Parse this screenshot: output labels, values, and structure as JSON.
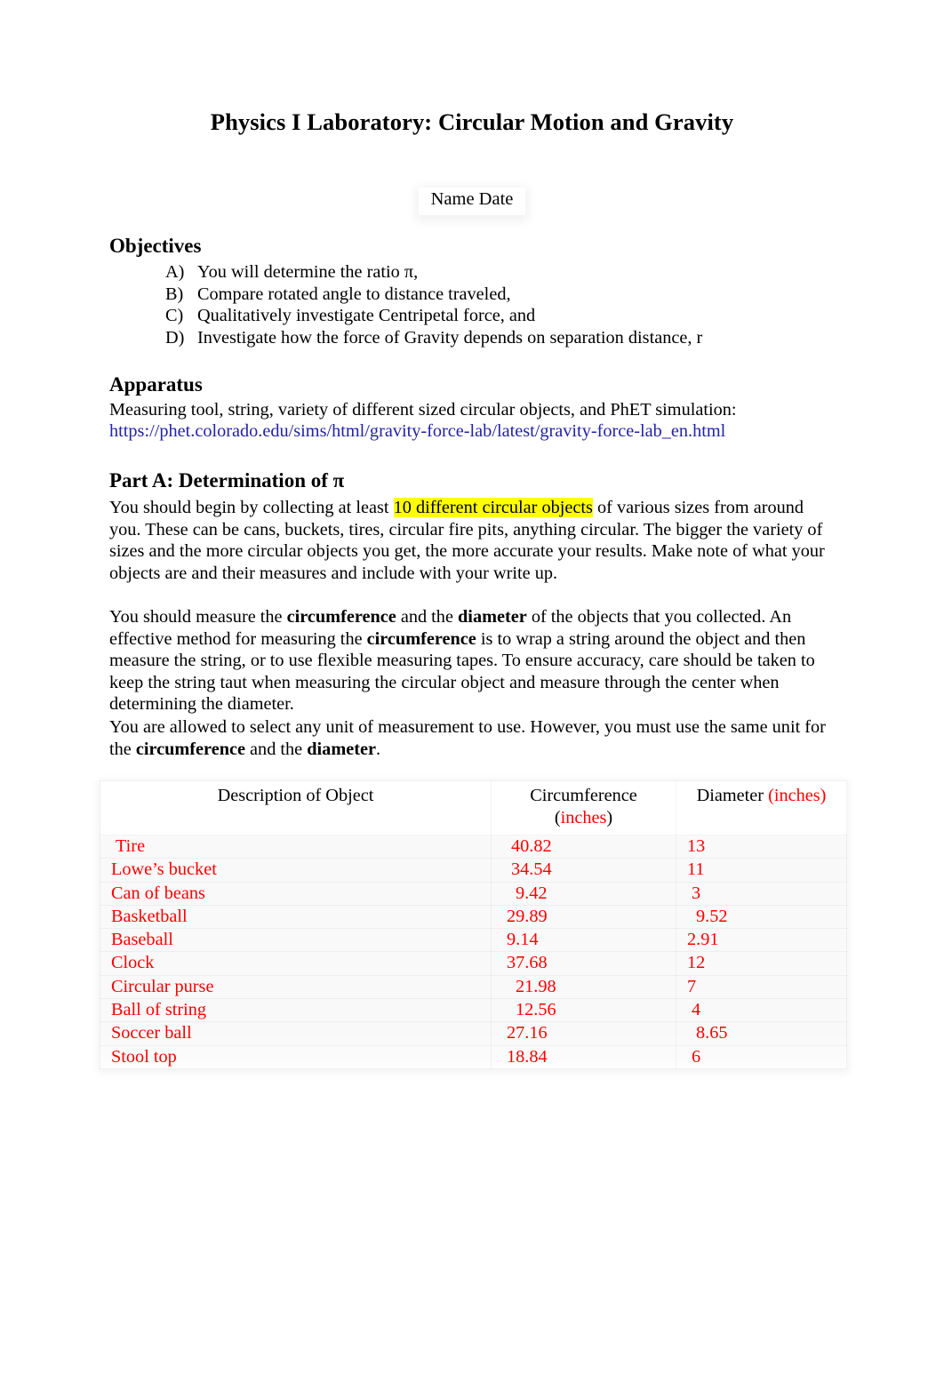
{
  "document": {
    "title": "Physics I Laboratory: Circular Motion and Gravity",
    "name_date": "Name Date"
  },
  "objectives": {
    "heading": "Objectives",
    "items": [
      {
        "letter": "A)",
        "text": "You will determine the ratio π,"
      },
      {
        "letter": "B)",
        "text": "Compare rotated angle to distance traveled,"
      },
      {
        "letter": "C)",
        "text": "Qualitatively investigate Centripetal force, and"
      },
      {
        "letter": "D)",
        "text": "Investigate how the force of Gravity depends on separation distance, r"
      }
    ]
  },
  "apparatus": {
    "heading": "Apparatus",
    "text": "Measuring tool, string, variety of different sized circular objects, and PhET simulation:",
    "link_text": "https://phet.colorado.edu/sims/html/gravity-force-lab/latest/gravity-force-lab_en.html",
    "link_color": "#2222a8"
  },
  "part_a": {
    "heading": "Part A: Determination of π",
    "para1_pre": "You should begin by collecting at least ",
    "para1_highlight": "10 different circular objects",
    "para1_post": " of various sizes from around you. These can be cans, buckets, tires, circular fire pits, anything circular. The bigger the variety of sizes and the more circular objects you get, the more accurate your results.  Make note of what your objects are and their measures and include with your write up.",
    "highlight_color": "#ffff00",
    "para2_s1": "You should measure the ",
    "para2_b1": "circumference",
    "para2_s2": " and the ",
    "para2_b2": "diameter",
    "para2_s3": " of the objects that you collected.  An effective method for measuring the ",
    "para2_b3": "circumference",
    "para2_s4": " is to wrap a string around the object and then measure the string, or to use flexible measuring tapes. To ensure accuracy, care should be taken to keep the string taut when measuring the circular object and measure through the center when determining the diameter.",
    "para3_s1": "You are allowed to select any unit of measurement to use. However, you must use the same unit for the ",
    "para3_b1": "circumference",
    "para3_s2": " and the ",
    "para3_b2": "diameter",
    "para3_s3": "."
  },
  "table": {
    "headers": {
      "col1": "Description of Object",
      "col2_main": "Circumference",
      "col2_unit_open": "(",
      "col2_unit": "inches",
      "col2_unit_close": ")",
      "col3_main": "Diameter ",
      "col3_unit": "(inches)"
    },
    "data_color": "#ff0000",
    "rows": [
      {
        "object": "Tire",
        "circumference": "40.82",
        "diameter": "13"
      },
      {
        "object": "Lowe’s bucket",
        "circumference": "34.54",
        "diameter": "11"
      },
      {
        "object": "Can of beans",
        "circumference": "9.42",
        "diameter": "3"
      },
      {
        "object": "Basketball",
        "circumference": "29.89",
        "diameter": "9.52"
      },
      {
        "object": "Baseball",
        "circumference": "9.14",
        "diameter": "2.91"
      },
      {
        "object": "Clock",
        "circumference": "37.68",
        "diameter": "12"
      },
      {
        "object": "Circular purse",
        "circumference": "21.98",
        "diameter": "7"
      },
      {
        "object": "Ball of string",
        "circumference": "12.56",
        "diameter": "4"
      },
      {
        "object": "Soccer ball",
        "circumference": "27.16",
        "diameter": "8.65"
      },
      {
        "object": "Stool top",
        "circumference": "18.84",
        "diameter": "6"
      }
    ]
  }
}
